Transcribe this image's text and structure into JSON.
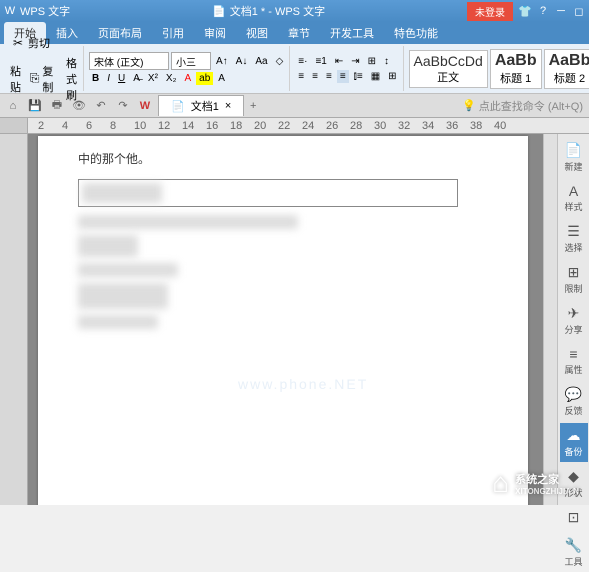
{
  "title": {
    "app": "WPS 文字",
    "doc_icon": "📄",
    "doc_name": "文档1 * - WPS 文字"
  },
  "titlebar_right": {
    "login": "未登录"
  },
  "tabs": [
    "开始",
    "插入",
    "页面布局",
    "引用",
    "审阅",
    "视图",
    "章节",
    "开发工具",
    "特色功能"
  ],
  "active_tab_index": 0,
  "ribbon": {
    "clipboard": {
      "cut": "剪切",
      "copy": "复制",
      "paste": "粘贴",
      "format": "格式刷"
    },
    "font": {
      "name": "宋体 (正文)",
      "size": "小三",
      "bold": "B",
      "italic": "I",
      "underline": "U",
      "strike": "A",
      "super": "X²",
      "sub": "X₂",
      "fontcolor": "A",
      "highlight": "A",
      "clear": "A"
    },
    "styles": [
      {
        "preview": "AaBbCcDd",
        "name": "正文"
      },
      {
        "preview": "AaBb",
        "name": "标题 1"
      },
      {
        "preview": "AaBb",
        "name": "标题 2"
      }
    ]
  },
  "doc_tabs": {
    "active": "文档1",
    "plus": "+"
  },
  "cmd_hint": "点此查找命令 (Alt+Q)",
  "ruler_marks": [
    "2",
    "4",
    "6",
    "8",
    "10",
    "12",
    "14",
    "16",
    "18",
    "20",
    "22",
    "24",
    "26",
    "28",
    "30",
    "32",
    "34",
    "36",
    "38",
    "40"
  ],
  "document": {
    "line1": "中的那个他。"
  },
  "watermark_text": "www.phone.NET",
  "sidepanel": [
    {
      "icon": "📄",
      "label": "新建"
    },
    {
      "icon": "A",
      "label": "样式"
    },
    {
      "icon": "☰",
      "label": "选择"
    },
    {
      "icon": "⊞",
      "label": "限制"
    },
    {
      "icon": "✈",
      "label": "分享"
    },
    {
      "icon": "≡",
      "label": "属性"
    },
    {
      "icon": "💬",
      "label": "反馈"
    },
    {
      "icon": "☁",
      "label": "备份"
    },
    {
      "icon": "◆",
      "label": "形状"
    },
    {
      "icon": "⊡",
      "label": ""
    },
    {
      "icon": "🔧",
      "label": "工具"
    }
  ],
  "sidepanel_active": 7,
  "footer": {
    "brand": "系统之家",
    "url": "XITONGZHIJIA.N"
  }
}
